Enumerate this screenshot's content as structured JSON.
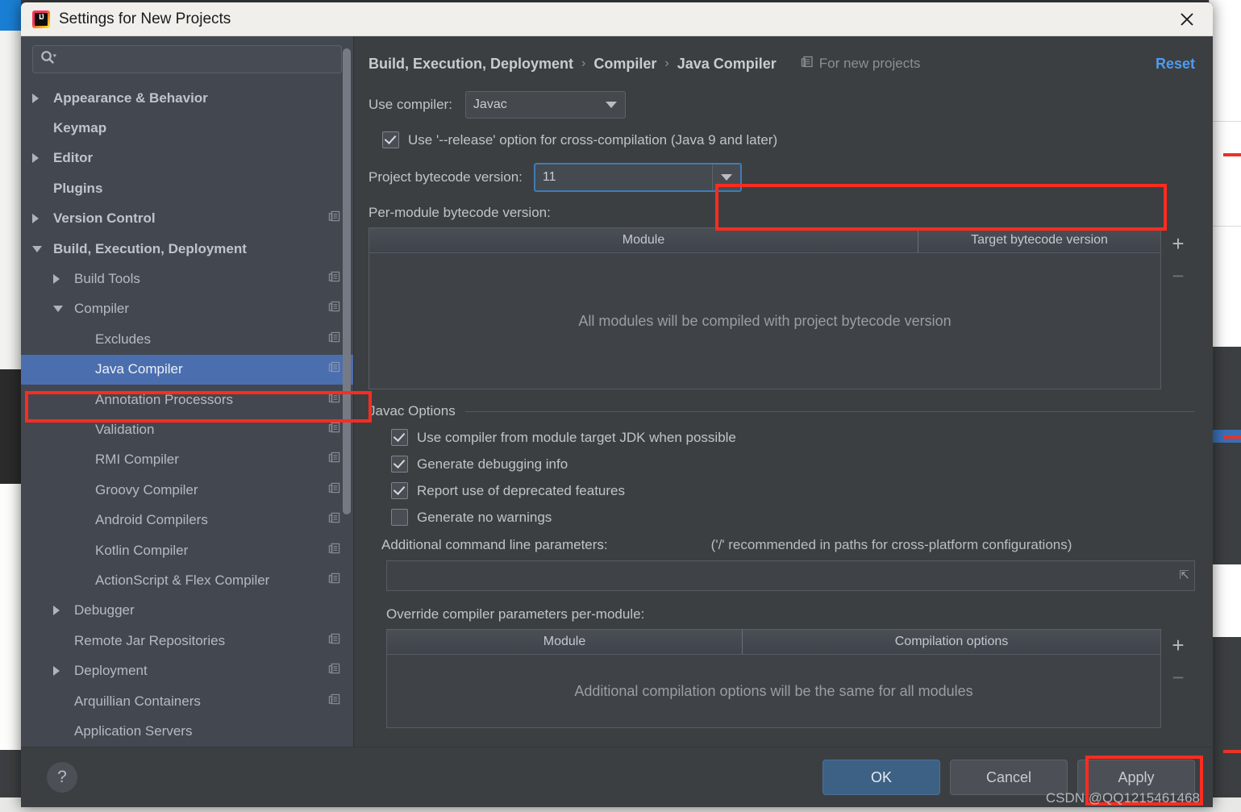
{
  "window": {
    "title": "Settings for New Projects",
    "logo_text": "IJ",
    "close_icon": "close-icon"
  },
  "sidebar": {
    "search": {
      "placeholder": "",
      "value": "",
      "icon": "search-icon"
    },
    "items": [
      {
        "label": "Appearance & Behavior",
        "indent": 0,
        "arrow": "right",
        "bold": true,
        "copy": false,
        "selected": false
      },
      {
        "label": "Keymap",
        "indent": 0,
        "arrow": "none",
        "bold": true,
        "copy": false,
        "selected": false
      },
      {
        "label": "Editor",
        "indent": 0,
        "arrow": "right",
        "bold": true,
        "copy": false,
        "selected": false
      },
      {
        "label": "Plugins",
        "indent": 0,
        "arrow": "none",
        "bold": true,
        "copy": false,
        "selected": false
      },
      {
        "label": "Version Control",
        "indent": 0,
        "arrow": "right",
        "bold": true,
        "copy": true,
        "selected": false
      },
      {
        "label": "Build, Execution, Deployment",
        "indent": 0,
        "arrow": "down",
        "bold": true,
        "copy": false,
        "selected": false
      },
      {
        "label": "Build Tools",
        "indent": 1,
        "arrow": "right",
        "bold": false,
        "copy": true,
        "selected": false
      },
      {
        "label": "Compiler",
        "indent": 1,
        "arrow": "down",
        "bold": false,
        "copy": true,
        "selected": false
      },
      {
        "label": "Excludes",
        "indent": 2,
        "arrow": "none",
        "bold": false,
        "copy": true,
        "selected": false
      },
      {
        "label": "Java Compiler",
        "indent": 2,
        "arrow": "none",
        "bold": false,
        "copy": true,
        "selected": true
      },
      {
        "label": "Annotation Processors",
        "indent": 2,
        "arrow": "none",
        "bold": false,
        "copy": true,
        "selected": false
      },
      {
        "label": "Validation",
        "indent": 2,
        "arrow": "none",
        "bold": false,
        "copy": true,
        "selected": false
      },
      {
        "label": "RMI Compiler",
        "indent": 2,
        "arrow": "none",
        "bold": false,
        "copy": true,
        "selected": false
      },
      {
        "label": "Groovy Compiler",
        "indent": 2,
        "arrow": "none",
        "bold": false,
        "copy": true,
        "selected": false
      },
      {
        "label": "Android Compilers",
        "indent": 2,
        "arrow": "none",
        "bold": false,
        "copy": true,
        "selected": false
      },
      {
        "label": "Kotlin Compiler",
        "indent": 2,
        "arrow": "none",
        "bold": false,
        "copy": true,
        "selected": false
      },
      {
        "label": "ActionScript & Flex Compiler",
        "indent": 2,
        "arrow": "none",
        "bold": false,
        "copy": true,
        "selected": false
      },
      {
        "label": "Debugger",
        "indent": 1,
        "arrow": "right",
        "bold": false,
        "copy": false,
        "selected": false
      },
      {
        "label": "Remote Jar Repositories",
        "indent": 1,
        "arrow": "none",
        "bold": false,
        "copy": true,
        "selected": false
      },
      {
        "label": "Deployment",
        "indent": 1,
        "arrow": "right",
        "bold": false,
        "copy": true,
        "selected": false
      },
      {
        "label": "Arquillian Containers",
        "indent": 1,
        "arrow": "none",
        "bold": false,
        "copy": true,
        "selected": false
      },
      {
        "label": "Application Servers",
        "indent": 1,
        "arrow": "none",
        "bold": false,
        "copy": false,
        "selected": false
      }
    ]
  },
  "header": {
    "breadcrumb": [
      "Build, Execution, Deployment",
      "Compiler",
      "Java Compiler"
    ],
    "separator": "›",
    "for_new_projects": "For new projects",
    "for_new_projects_icon": "copy-scope-icon",
    "reset_label": "Reset"
  },
  "main": {
    "use_compiler_label": "Use compiler:",
    "use_compiler_value": "Javac",
    "release_option_label": "Use '--release' option for cross-compilation (Java 9 and later)",
    "release_option_checked": true,
    "project_bytecode_label": "Project bytecode version:",
    "project_bytecode_value": "11",
    "per_module_label": "Per-module bytecode version:",
    "module_table": {
      "columns": [
        "Module",
        "Target bytecode version"
      ],
      "empty_text": "All modules will be compiled with project bytecode version",
      "add_icon": "plus-icon",
      "remove_icon": "minus-icon"
    },
    "javac_group_label": "Javac Options",
    "javac_options": [
      {
        "label": "Use compiler from module target JDK when possible",
        "checked": true
      },
      {
        "label": "Generate debugging info",
        "checked": true
      },
      {
        "label": "Report use of deprecated features",
        "checked": true
      },
      {
        "label": "Generate no warnings",
        "checked": false
      }
    ],
    "additional_params_label": "Additional command line parameters:",
    "additional_params_hint": "('/' recommended in paths for cross-platform configurations)",
    "additional_params_value": "",
    "expand_icon": "expand-icon",
    "override_label": "Override compiler parameters per-module:",
    "override_table": {
      "columns": [
        "Module",
        "Compilation options"
      ],
      "empty_text": "Additional compilation options will be the same for all modules",
      "add_icon": "plus-icon",
      "remove_icon": "minus-icon"
    }
  },
  "footer": {
    "help_label": "?",
    "ok_label": "OK",
    "cancel_label": "Cancel",
    "apply_label": "Apply"
  },
  "watermark": "CSDN @QQ1215461468",
  "colors": {
    "accent_blue": "#4b6eaf",
    "link_blue": "#4e9bf0",
    "highlight_red": "#fb2c21",
    "panel_bg": "#3c3f41",
    "sidebar_bg": "#434750",
    "titlebar_bg": "#f0efeb"
  }
}
